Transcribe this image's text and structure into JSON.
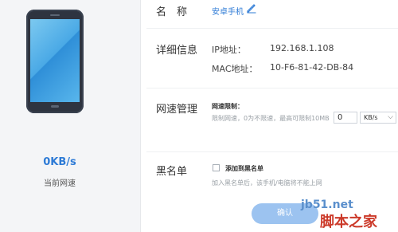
{
  "device": {
    "speed_value": "0KB/s",
    "speed_label": "当前网速"
  },
  "name_row": {
    "label": "名　称",
    "value": "安卓手机"
  },
  "details_row": {
    "label": "详细信息",
    "ip_key": "IP地址：",
    "ip_value": "192.168.1.108",
    "mac_key": "MAC地址：",
    "mac_value": "10-F6-81-42-DB-84"
  },
  "speed_row": {
    "label": "网速管理",
    "limit_title": "网速限制：",
    "limit_hint": "限制网速，0为不限速，最高可限制10MB",
    "input_value": "0",
    "unit": "KB/s"
  },
  "blacklist_row": {
    "label": "黑名单",
    "checkbox_label": "添加到黑名单",
    "hint": "加入黑名单后，该手机/电脑将不能上网"
  },
  "actions": {
    "confirm": "确认"
  },
  "watermark": {
    "line1": "jb51.net",
    "line2": "脚本之家"
  },
  "colors": {
    "accent": "#2e7bd6",
    "button": "#9cc3f0"
  }
}
